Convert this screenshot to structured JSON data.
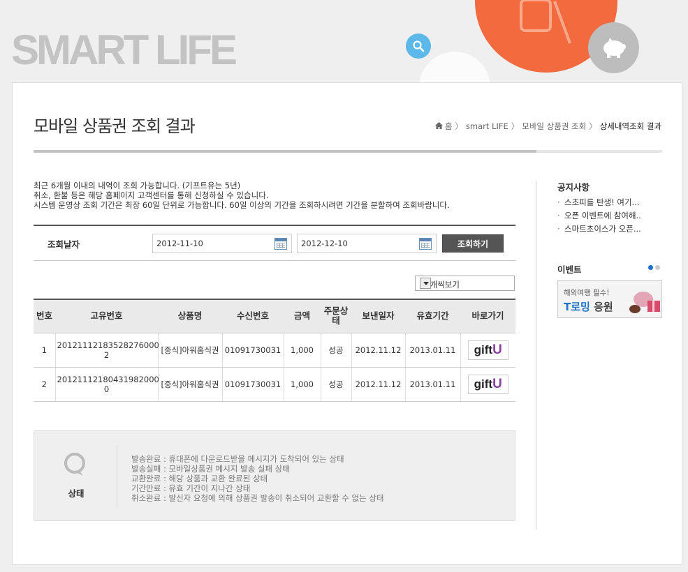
{
  "header": {
    "brand": "SMART LIFE",
    "icons": [
      "search-icon",
      "phone-icon",
      "piggy-bank-icon"
    ],
    "colors": {
      "accent_orange": "#f26a3e",
      "accent_blue": "#5bb8e9"
    }
  },
  "page": {
    "title": "모바일 상품권 조회 결과",
    "breadcrumb": {
      "home": "홈",
      "items": [
        "smart LIFE",
        "모바일 상품권 조회"
      ],
      "current": "상세내역조회 결과"
    }
  },
  "notices": [
    "최근 6개월 이내의 내역이 조회 가능합니다. (기프트유는 5년)",
    "취소, 환불 등은 해당 홈페이지 고객센터를 통해 신청하실 수 있습니다.",
    "시스템 운영상 조회 기간은 최장 60일 단위로 가능합니다. 60일 이상의 기간을 조회하시려면 기간을 분할하여 조회바랍니다."
  ],
  "search": {
    "label": "조회날자",
    "start_date": "2012-11-10",
    "end_date": "2012-12-10",
    "button": "조회하기"
  },
  "per_page": {
    "selected": "10개씩보기"
  },
  "table": {
    "headers": [
      "번호",
      "고유번호",
      "상품명",
      "수신번호",
      "금액",
      "주문상태",
      "보낸일자",
      "유효기간",
      "바로가기"
    ],
    "rows": [
      {
        "no": "1",
        "id": "20121112183528276000 2",
        "product": "[중식]아워홈식권",
        "phone": "01091730031",
        "amount": "1,000",
        "status": "성공",
        "sent": "2012.11.12",
        "expires": "2013.01.11",
        "link": "gift U"
      },
      {
        "no": "2",
        "id": "20121112180431982000 0",
        "product": "[중식]아워홈식권",
        "phone": "01091730031",
        "amount": "1,000",
        "status": "성공",
        "sent": "2012.11.12",
        "expires": "2013.01.11",
        "link": "gift U"
      }
    ]
  },
  "status_box": {
    "label": "상태",
    "lines": [
      "발송완료 : 휴대폰에 다운로드받을 메시지가 도착되어 있는 상태",
      "발송실패 : 모바일상품권 메시지 발송 실패 상태",
      "교환완료 : 해당 상품과 교환 완료된 상태",
      "기간만료 : 유효 기간이 지나간 상태",
      "취소완료 : 발신자 요청에 의해 상품권 발송이 취소되어 교환할 수 없는 상태"
    ]
  },
  "sidebar": {
    "notice_title": "공지사항",
    "notice_items": [
      "스초피를 탄생! 여기...",
      "오픈 이벤트에 참여해..",
      "스마트초이스가 오픈..."
    ],
    "event_title": "이벤트",
    "event_banner": {
      "line1": "해외여행 필수!",
      "line2_blue": "T로밍",
      "line2_rest": " 응원"
    }
  }
}
